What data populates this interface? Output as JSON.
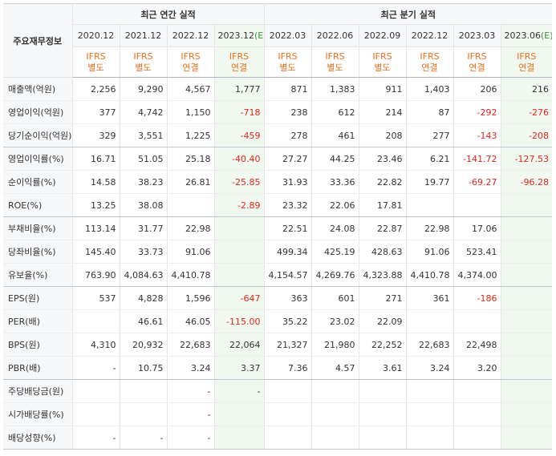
{
  "header": {
    "corner_label": "주요재무정보",
    "annual_title": "최근 연간 실적",
    "quarter_title": "최근 분기 실적",
    "periods": [
      {
        "label": "2020.12",
        "est": ""
      },
      {
        "label": "2021.12",
        "est": ""
      },
      {
        "label": "2022.12",
        "est": ""
      },
      {
        "label": "2023.12",
        "est": "(E)"
      },
      {
        "label": "2022.03",
        "est": ""
      },
      {
        "label": "2022.06",
        "est": ""
      },
      {
        "label": "2022.09",
        "est": ""
      },
      {
        "label": "2022.12",
        "est": ""
      },
      {
        "label": "2023.03",
        "est": ""
      },
      {
        "label": "2023.06",
        "est": "(E)"
      }
    ],
    "standards": [
      {
        "top": "IFRS",
        "bottom": "별도"
      },
      {
        "top": "IFRS",
        "bottom": "별도"
      },
      {
        "top": "IFRS",
        "bottom": "연결"
      },
      {
        "top": "IFRS",
        "bottom": "연결"
      },
      {
        "top": "IFRS",
        "bottom": "별도"
      },
      {
        "top": "IFRS",
        "bottom": "별도"
      },
      {
        "top": "IFRS",
        "bottom": "별도"
      },
      {
        "top": "IFRS",
        "bottom": "연결"
      },
      {
        "top": "IFRS",
        "bottom": "연결"
      },
      {
        "top": "IFRS",
        "bottom": "연결"
      }
    ]
  },
  "rows": [
    {
      "label": "매출액(억원)",
      "values": [
        "2,256",
        "9,290",
        "4,567",
        "1,777",
        "871",
        "1,383",
        "911",
        "1,403",
        "206",
        "216"
      ]
    },
    {
      "label": "영업이익(억원)",
      "values": [
        "377",
        "4,742",
        "1,150",
        "-718",
        "238",
        "612",
        "214",
        "87",
        "-292",
        "-276"
      ]
    },
    {
      "label": "당기순이익(억원)",
      "values": [
        "329",
        "3,551",
        "1,225",
        "-459",
        "278",
        "461",
        "208",
        "277",
        "-143",
        "-208"
      ]
    },
    {
      "label": "영업이익률(%)",
      "values": [
        "16.71",
        "51.05",
        "25.18",
        "-40.40",
        "27.27",
        "44.25",
        "23.46",
        "6.21",
        "-141.72",
        "-127.53"
      ]
    },
    {
      "label": "순이익률(%)",
      "values": [
        "14.58",
        "38.23",
        "26.81",
        "-25.85",
        "31.93",
        "33.36",
        "22.82",
        "19.77",
        "-69.27",
        "-96.28"
      ]
    },
    {
      "label": "ROE(%)",
      "values": [
        "13.25",
        "38.08",
        "",
        "-2.89",
        "23.32",
        "22.06",
        "17.81",
        "",
        "",
        ""
      ]
    },
    {
      "label": "부채비율(%)",
      "values": [
        "113.14",
        "31.77",
        "22.98",
        "",
        "22.51",
        "24.08",
        "22.87",
        "22.98",
        "17.06",
        ""
      ]
    },
    {
      "label": "당좌비율(%)",
      "values": [
        "145.40",
        "33.73",
        "91.06",
        "",
        "499.34",
        "425.19",
        "428.63",
        "91.06",
        "523.41",
        ""
      ]
    },
    {
      "label": "유보율(%)",
      "values": [
        "763.90",
        "4,084.63",
        "4,410.78",
        "",
        "4,154.57",
        "4,269.76",
        "4,323.88",
        "4,410.78",
        "4,374.00",
        ""
      ]
    },
    {
      "label": "EPS(원)",
      "values": [
        "537",
        "4,828",
        "1,596",
        "-647",
        "363",
        "601",
        "271",
        "361",
        "-186",
        ""
      ]
    },
    {
      "label": "PER(배)",
      "values": [
        "",
        "46.61",
        "46.05",
        "-115.00",
        "35.22",
        "23.02",
        "22.09",
        "",
        "",
        ""
      ]
    },
    {
      "label": "BPS(원)",
      "values": [
        "4,310",
        "20,932",
        "22,683",
        "22,064",
        "21,327",
        "21,980",
        "22,252",
        "22,683",
        "22,498",
        ""
      ]
    },
    {
      "label": "PBR(배)",
      "values": [
        "-",
        "10.75",
        "3.24",
        "3.37",
        "7.36",
        "4.57",
        "3.61",
        "3.24",
        "3.20",
        ""
      ]
    },
    {
      "label": "주당배당금(원)",
      "values": [
        "",
        "",
        "-",
        "-",
        "",
        "",
        "",
        "",
        "",
        ""
      ]
    },
    {
      "label": "시가배당률(%)",
      "values": [
        "",
        "",
        "-",
        "",
        "",
        "",
        "",
        "",
        "",
        ""
      ]
    },
    {
      "label": "배당성향(%)",
      "values": [
        "-",
        "-",
        "-",
        "",
        "",
        "",
        "",
        "",
        "",
        ""
      ]
    }
  ]
}
